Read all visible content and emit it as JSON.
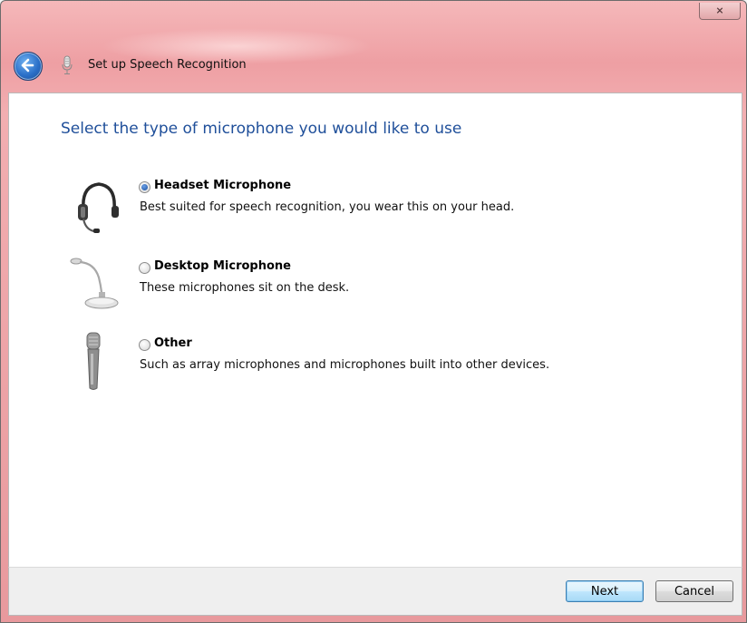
{
  "window": {
    "close_label": "⨯",
    "title": "Set up Speech Recognition"
  },
  "heading": "Select the type of microphone you would like to use",
  "options": [
    {
      "label": "Headset Microphone",
      "description": "Best suited for speech recognition, you wear this on your head.",
      "selected": true,
      "icon": "headset-icon"
    },
    {
      "label": "Desktop Microphone",
      "description": "These microphones sit on the desk.",
      "selected": false,
      "icon": "desktop-microphone-icon"
    },
    {
      "label": "Other",
      "description": "Such as array microphones and microphones built into other devices.",
      "selected": false,
      "icon": "handheld-microphone-icon"
    }
  ],
  "buttons": {
    "next": "Next",
    "cancel": "Cancel"
  },
  "colors": {
    "titlebar": "#ee9fa3",
    "heading": "#1f4f9a",
    "default_button_border": "#3c7fb1"
  }
}
